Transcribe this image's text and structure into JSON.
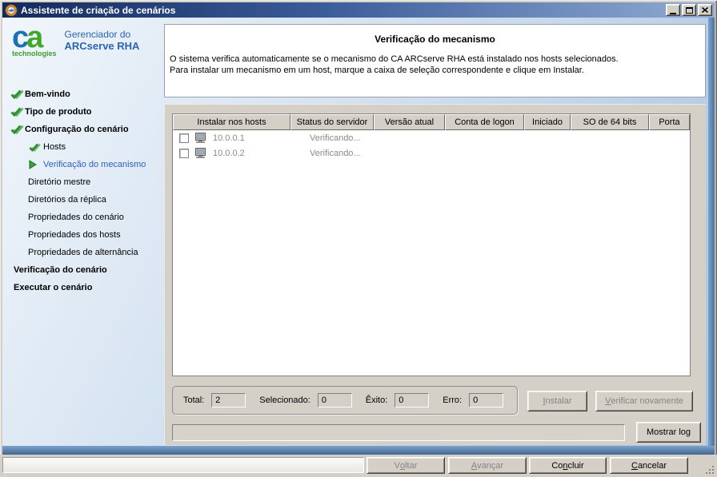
{
  "window": {
    "title": "Assistente de criação de cenários"
  },
  "brand": {
    "logo_c": "c",
    "logo_a": "a",
    "logo_sub": "technologies",
    "product_line1": "Gerenciador do",
    "product_line2": "ARCserve RHA"
  },
  "sidebar": {
    "items": [
      {
        "label": "Bem-vindo",
        "state": "done"
      },
      {
        "label": "Tipo de produto",
        "state": "done"
      },
      {
        "label": "Configuração do cenário",
        "state": "done"
      },
      {
        "label": "Hosts",
        "state": "done"
      },
      {
        "label": "Verificação do mecanismo",
        "state": "current"
      },
      {
        "label": "Diretório mestre",
        "state": "pending"
      },
      {
        "label": "Diretórios da réplica",
        "state": "pending"
      },
      {
        "label": "Propriedades do cenário",
        "state": "pending"
      },
      {
        "label": "Propriedades dos hosts",
        "state": "pending"
      },
      {
        "label": "Propriedades de alternância",
        "state": "pending"
      },
      {
        "label": "Verificação do cenário",
        "state": "pending"
      },
      {
        "label": "Executar o cenário",
        "state": "pending"
      }
    ]
  },
  "header": {
    "title": "Verificação do mecanismo",
    "line1": "O sistema verifica automaticamente se o mecanismo do CA ARCserve RHA está instalado nos hosts selecionados.",
    "line2": "Para instalar um mecanismo em um host, marque a caixa de seleção correspondente e clique em Instalar."
  },
  "table": {
    "columns": [
      "Instalar nos hosts",
      "Status do servidor",
      "Versão atual",
      "Conta de logon",
      "Iniciado",
      "SO de 64 bits",
      "Porta"
    ],
    "rows": [
      {
        "host": "10.0.0.1",
        "status": "Verificando...",
        "checked": false
      },
      {
        "host": "10.0.0.2",
        "status": "Verificando...",
        "checked": false
      }
    ]
  },
  "stats": {
    "items": [
      {
        "label": "Total:",
        "value": "2"
      },
      {
        "label": "Selecionado:",
        "value": "0"
      },
      {
        "label": "Êxito:",
        "value": "0"
      },
      {
        "label": "Erro:",
        "value": "0"
      }
    ]
  },
  "actions": {
    "install": {
      "pre": "",
      "key": "I",
      "post": "nstalar"
    },
    "verify_again": {
      "pre": "",
      "key": "V",
      "post": "erificar novamente"
    },
    "show_log": "Mostrar log"
  },
  "footer": {
    "back": {
      "pre": "V",
      "key": "o",
      "post": "ltar"
    },
    "next": {
      "pre": "",
      "key": "A",
      "post": "vançar"
    },
    "finish": {
      "pre": "Co",
      "key": "n",
      "post": "cluir"
    },
    "cancel": {
      "pre": "",
      "key": "C",
      "post": "ancelar"
    }
  },
  "colors": {
    "titlebar_navy": "#13295c",
    "accent_green": "#2f8f2f",
    "current_step_blue": "#2f5fc4",
    "panel_gray": "#d4d0c8",
    "edge_blue": "#48739d"
  }
}
